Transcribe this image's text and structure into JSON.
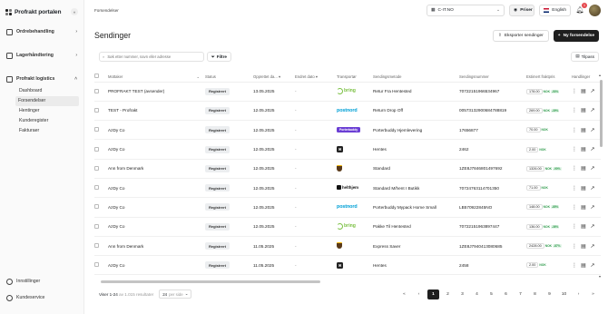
{
  "brand": {
    "name": "Profrakt portalen"
  },
  "sidebar": {
    "groups": [
      {
        "label": "Ordrebehandling",
        "chevron": "›"
      },
      {
        "label": "Lagerhåndtering",
        "chevron": "›"
      },
      {
        "label": "Profrakt logistics",
        "chevron": "˄"
      }
    ],
    "sub_items": [
      "Dashboard",
      "Forsendelser",
      "Hentinger",
      "Kunderegister",
      "Fakturaer"
    ],
    "active_item": "Forsendelser",
    "bottom": [
      {
        "label": "Innstillinger",
        "icon": "gear-icon"
      },
      {
        "label": "Kundeservice",
        "icon": "support-icon"
      }
    ]
  },
  "topbar": {
    "breadcrumb": "Forsendelser",
    "company": "C-IT.NO",
    "prices_label": "Priser",
    "language": "English",
    "notification_count": "1"
  },
  "page": {
    "title": "Sendinger",
    "export_label": "Eksporter sendinger",
    "new_label": "Ny forsendelse"
  },
  "filters": {
    "search_placeholder": "Søk etter nummer, navn eller adresse",
    "filter_label": "Filtre",
    "adjust_label": "Tilpass"
  },
  "table": {
    "columns": [
      "Mottaker",
      "Status",
      "Opprettet da...",
      "Endret dato",
      "Transportør",
      "Sendingsmetode",
      "Sendingsnummer",
      "Estimert fraktpris",
      "Handlinger"
    ],
    "rows": [
      {
        "recipient": "PROFRAKT TEST (avsender)",
        "status": "Registrert",
        "created": "13.05.2025",
        "changed": "-",
        "carrier": "bring",
        "carrier_label": "bring",
        "method": "Retur Fra Hentested",
        "number": "70722151966534967",
        "price": "178.00",
        "currency": "NOK",
        "discount": "-53%"
      },
      {
        "recipient": "TEST - Profrakt",
        "status": "Registrert",
        "created": "12.05.2025",
        "changed": "-",
        "carrier": "postnord",
        "carrier_label": "postnord",
        "method": "Return Drop Off",
        "number": "00573132900684788819",
        "price": "269.00",
        "currency": "NOK",
        "discount": "-39%"
      },
      {
        "recipient": "AzDy Co",
        "status": "Registrert",
        "created": "12.05.2025",
        "changed": "-",
        "carrier": "porterbuddy",
        "carrier_label": "Porterbuddy",
        "method": "Porterbuddy Hjemlevering",
        "number": "17656877",
        "price": "70.00",
        "currency": "NOK",
        "discount": ""
      },
      {
        "recipient": "AzDy Co",
        "status": "Registrert",
        "created": "12.05.2025",
        "changed": "-",
        "carrier": "square",
        "carrier_label": "",
        "method": "Hentes",
        "number": "2462",
        "price": "2.00",
        "currency": "NOK",
        "discount": ""
      },
      {
        "recipient": "Ann from Denmark",
        "status": "Registrert",
        "created": "12.05.2025",
        "changed": "-",
        "carrier": "ups",
        "carrier_label": "",
        "method": "Standard",
        "number": "1ZE8J7846801497692",
        "price": "1326.00",
        "currency": "NOK",
        "discount": "-90%"
      },
      {
        "recipient": "AzDy Co",
        "status": "Registrert",
        "created": "12.05.2025",
        "changed": "-",
        "carrier": "helthjem",
        "carrier_label": "helthjem",
        "method": "Standard M/hent I Butikk",
        "number": "70724763114701350",
        "price": "71.00",
        "currency": "NOK",
        "discount": ""
      },
      {
        "recipient": "AzDy Co",
        "status": "Registrert",
        "created": "12.05.2025",
        "changed": "-",
        "carrier": "postnord",
        "carrier_label": "postnord",
        "method": "Porterbuddy Mypack Home Small",
        "number": "LB570922845NO",
        "price": "148.00",
        "currency": "NOK",
        "discount": "-85%"
      },
      {
        "recipient": "AzDy Co",
        "status": "Registrert",
        "created": "12.05.2025",
        "changed": "-",
        "carrier": "bring",
        "carrier_label": "bring",
        "method": "Pakke Til Hentested",
        "number": "70722151963897447",
        "price": "136.00",
        "currency": "NOK",
        "discount": "-36%"
      },
      {
        "recipient": "Ann from Denmark",
        "status": "Registrert",
        "created": "11.05.2025",
        "changed": "-",
        "carrier": "ups",
        "carrier_label": "",
        "method": "Express Saver",
        "number": "1ZE8J7940413080685",
        "price": "2428.00",
        "currency": "NOK",
        "discount": "-87%"
      },
      {
        "recipient": "AzDy Co",
        "status": "Registrert",
        "created": "11.05.2025",
        "changed": "-",
        "carrier": "square",
        "carrier_label": "",
        "method": "Hentes",
        "number": "2458",
        "price": "2.00",
        "currency": "NOK",
        "discount": ""
      }
    ]
  },
  "footer": {
    "showing": "Viser 1-24",
    "of_text": "av 1.015 resultater",
    "per_page": "24",
    "per_page_suffix": "per side",
    "pages": [
      "«",
      "‹",
      "1",
      "2",
      "3",
      "4",
      "5",
      "6",
      "7",
      "8",
      "9",
      "10",
      "›",
      "»"
    ],
    "active_page": "1"
  },
  "colors": {
    "accent": "#1f1f1f",
    "bring": "#7bc043",
    "postnord": "#00a0d6",
    "porterbuddy": "#6b3fd4",
    "badge": "#e5484d"
  }
}
